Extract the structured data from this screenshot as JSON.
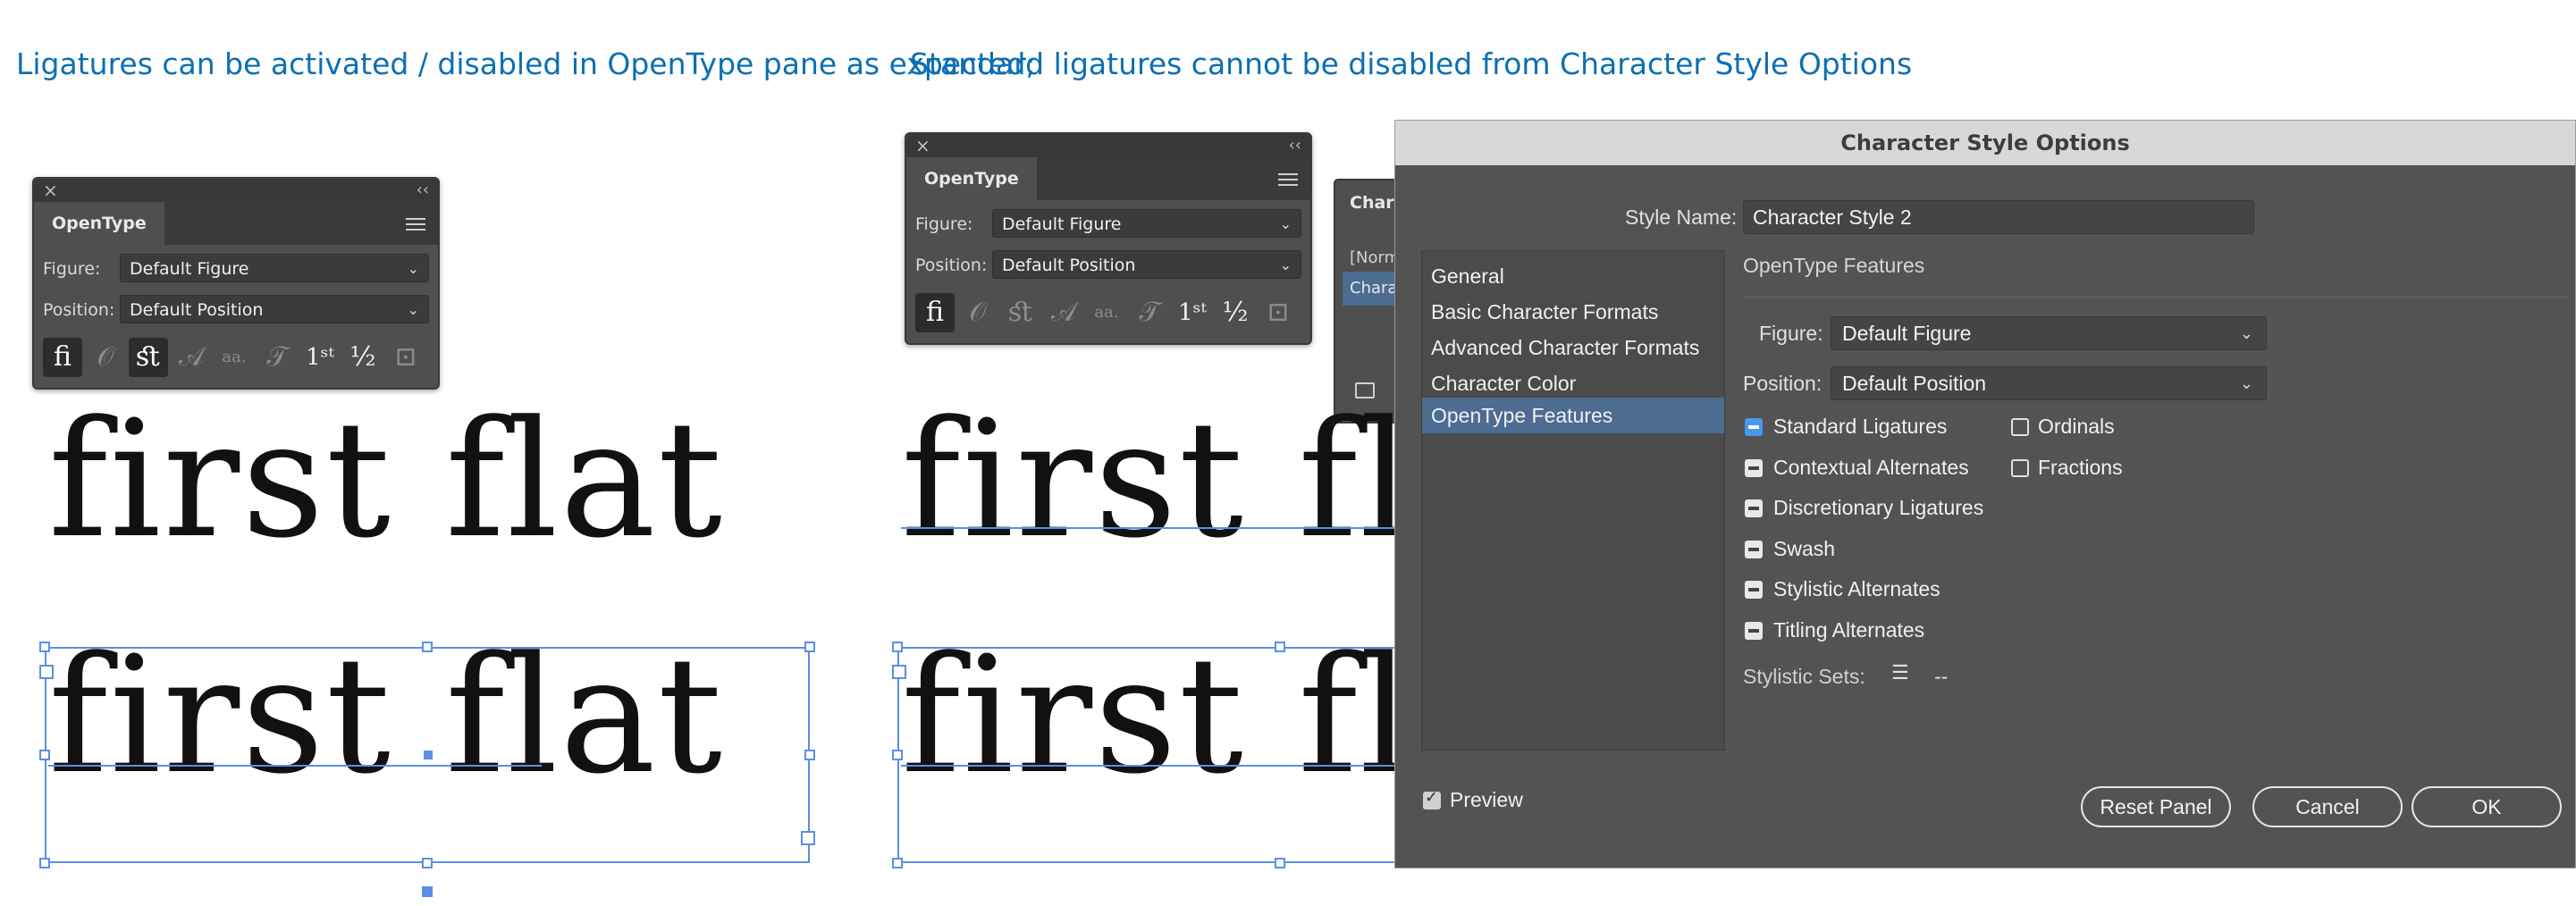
{
  "captions": {
    "left": "Ligatures can be activated / disabled in OpenType pane as expected;",
    "right": "Standard ligatures cannot be disabled from Character Style Options"
  },
  "opentype_panel_left": {
    "close": "×",
    "collapse": "‹‹",
    "tab": "OpenType",
    "figure_label": "Figure:",
    "figure_value": "Default Figure",
    "position_label": "Position:",
    "position_value": "Default Position",
    "buttons": [
      "ﬁ",
      "𝒪",
      "ﬆ",
      "𝒜",
      "aa.",
      "𝒯",
      "1ˢᵗ",
      "½",
      "⊡"
    ]
  },
  "opentype_panel_right": {
    "close": "×",
    "collapse": "‹‹",
    "tab": "OpenType",
    "figure_label": "Figure:",
    "figure_value": "Default Figure",
    "position_label": "Position:",
    "position_value": "Default Position",
    "buttons": [
      "ﬁ",
      "𝒪",
      "ﬆ",
      "𝒜",
      "aa.",
      "𝒯",
      "1ˢᵗ",
      "½",
      "⊡"
    ]
  },
  "char_styles_panel": {
    "tab": "Chara",
    "item1": "[Norm",
    "item2": "Chara"
  },
  "sample_text": {
    "top_left": "first flat",
    "bottom_left": "first flat",
    "top_right": "first flat",
    "bottom_right": "first flat"
  },
  "dialog": {
    "title": "Character Style Options",
    "style_name_label": "Style Name:",
    "style_name_value": "Character Style 2",
    "section_title": "OpenType Features",
    "nav": [
      "General",
      "Basic Character Formats",
      "Advanced Character Formats",
      "Character Color",
      "OpenType Features"
    ],
    "figure_label": "Figure:",
    "figure_value": "Default Figure",
    "position_label": "Position:",
    "position_value": "Default Position",
    "features_left": [
      "Standard Ligatures",
      "Contextual Alternates",
      "Discretionary Ligatures",
      "Swash",
      "Stylistic Alternates",
      "Titling Alternates"
    ],
    "features_right": [
      "Ordinals",
      "Fractions"
    ],
    "stylistic_sets_label": "Stylistic Sets:",
    "stylistic_sets_value": "--",
    "preview_label": "Preview",
    "buttons": {
      "reset": "Reset Panel",
      "cancel": "Cancel",
      "ok": "OK"
    }
  },
  "colors": {
    "caption": "#0c6fb3",
    "panel_bg": "#4f4f4f",
    "dialog_bg": "#535353",
    "selection": "#5a8fe6",
    "nav_active": "#4c6c92"
  }
}
